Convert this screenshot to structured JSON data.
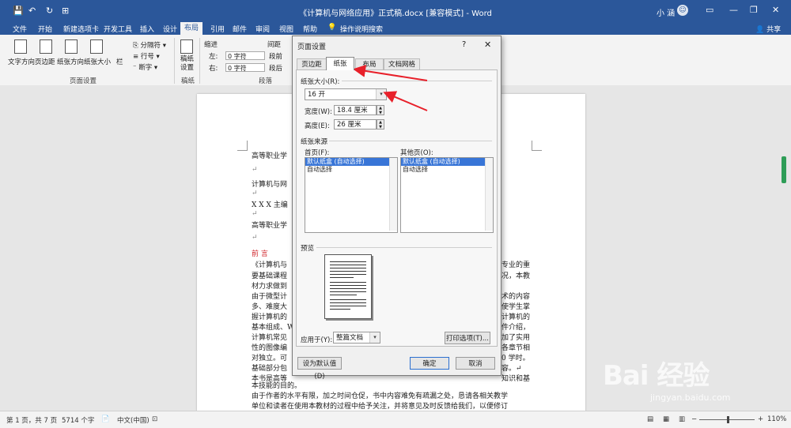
{
  "titlebar": {
    "title": "《计算机与网络应用》正式稿.docx [兼容模式] - Word",
    "user": "小 涵",
    "avatar": "☺",
    "quick_access": [
      "💾",
      "↶",
      "↻",
      "⊞"
    ]
  },
  "tabs": {
    "file": "文件",
    "home": "开始",
    "newtab": "新建选项卡",
    "dev": "开发工具",
    "insert": "插入",
    "design": "设计",
    "layout": "布局",
    "ref": "引用",
    "mail": "邮件",
    "review": "审阅",
    "view": "视图",
    "help": "帮助",
    "tellme": "操作说明搜索",
    "share": "共享"
  },
  "ribbon": {
    "text_dir": "文字方向",
    "margins": "页边距",
    "orientation": "纸张方向",
    "size": "纸张大小",
    "columns": "栏",
    "breaks": "分隔符",
    "line_numbers": "行号",
    "hyphenation": "断字",
    "page_setup_group": "页面设置",
    "draft": "稿纸\n设置",
    "draft_group": "稿纸",
    "indent": "缩进",
    "left": "左:",
    "right": "右:",
    "indent_left": "0 字符",
    "indent_right": "0 字符",
    "spacing": "间距",
    "before": "段前",
    "after": "段后",
    "para_group": "段落"
  },
  "document": {
    "lines": [
      "高等职业学",
      "计算机与网",
      "X X X  主编",
      "高等职业学",
      "前 言",
      "《计算机与",
      "要基础课程",
      "材力求做到",
      "由于微型计",
      "多、难度大",
      "握计算机的",
      "基本组成、W",
      "计算机常见",
      "性的图像编",
      "对独立。可",
      "基础部分包",
      "本书是高等",
      "本技能的目的。",
      "由于作者的水平有限，加之时间仓促，书中内容难免有疏漏之处，恳请各相关教学",
      "单位和读者在使用本教材的过程中给予关注，并将意见及时反馈给我们，以便修订"
    ],
    "right_fragments": [
      "专业的重",
      "况，本教",
      "术的内容",
      "使学生掌",
      "计算机的",
      "件介绍，",
      "加了实用",
      "各章节相",
      "0 学时。",
      "容。↵",
      "知识和基"
    ],
    "para_mark": "↵"
  },
  "dialog": {
    "title": "页面设置",
    "help": "?",
    "close": "✕",
    "tabs": [
      "页边距",
      "纸张",
      "布局",
      "文档网格"
    ],
    "paper_size_label": "纸张大小(R):",
    "paper_size_value": "16 开",
    "width_label": "宽度(W):",
    "width_value": "18.4 厘米",
    "height_label": "高度(E):",
    "height_value": "26 厘米",
    "source_label": "纸张来源",
    "first_page_label": "首页(F):",
    "other_pages_label": "其他页(O):",
    "tray_items": [
      "默认纸盒 (自动选择)",
      "自动选择"
    ],
    "preview_label": "预览",
    "apply_label": "应用于(Y):",
    "apply_value": "整篇文档",
    "print_options": "打印选项(T)...",
    "set_default": "设为默认值(D)",
    "ok": "确定",
    "cancel": "取消"
  },
  "statusbar": {
    "page": "第 1 页，共 7 页",
    "words": "5714 个字",
    "lang": "中文(中国)",
    "zoom": "110%",
    "zoom_minus": "−",
    "zoom_plus": "+"
  },
  "watermark": {
    "brand": "Bai 经验",
    "url": "jingyan.baidu.com"
  },
  "colors": {
    "accent": "#2b579a",
    "arrow": "#e8202a",
    "selection": "#3875d7"
  }
}
